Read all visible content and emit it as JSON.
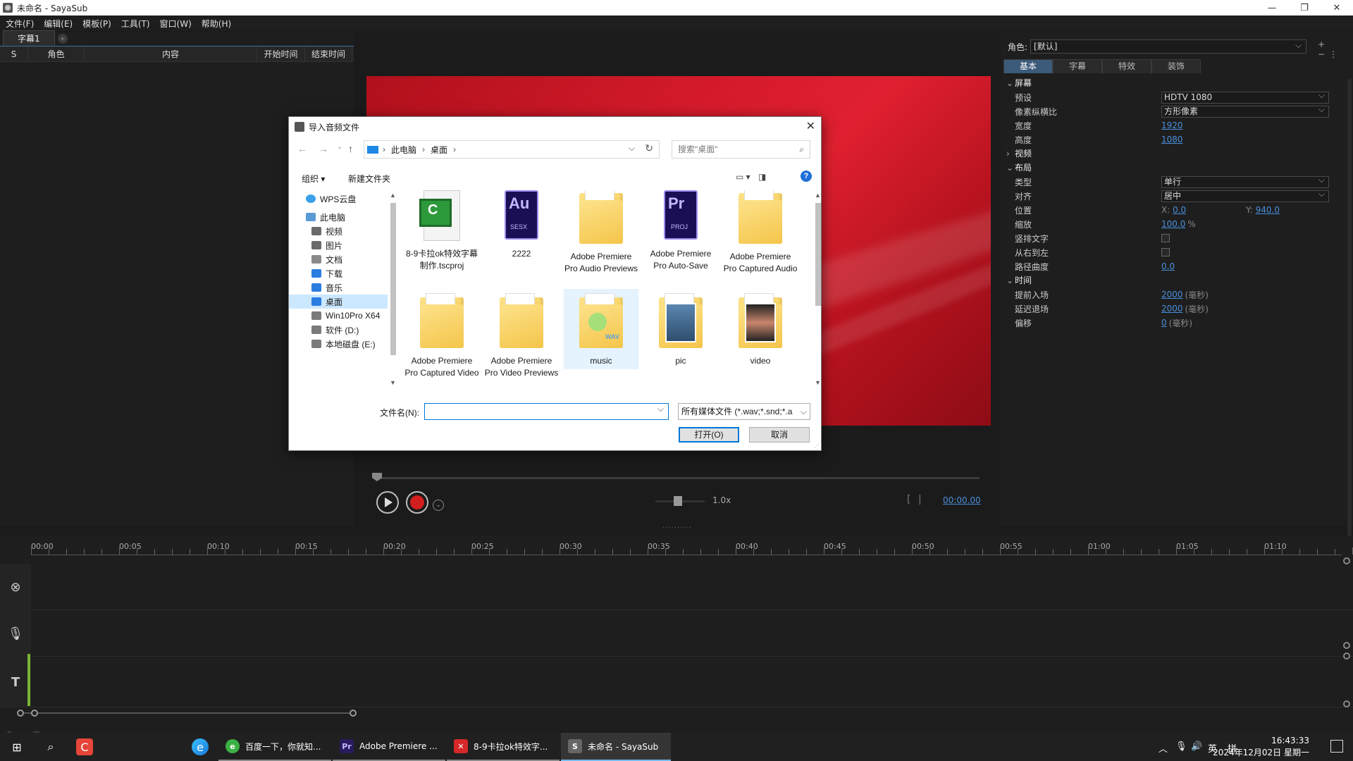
{
  "window": {
    "title": "未命名 - SayaSub",
    "buttons": [
      "—",
      "❐",
      "✕"
    ]
  },
  "menu": [
    "文件(F)",
    "编辑(E)",
    "模板(P)",
    "工具(T)",
    "窗口(W)",
    "帮助(H)"
  ],
  "subtitle_list": {
    "tab": "字幕1",
    "columns": [
      "S",
      "角色",
      "内容",
      "开始时间",
      "结束时间"
    ]
  },
  "player": {
    "speed": "1.0x",
    "time": "00:00.00"
  },
  "properties": {
    "role_label": "角色:",
    "role_value": "[默认]",
    "tabs": [
      "基本",
      "字幕",
      "特效",
      "装饰"
    ],
    "sections": {
      "screen": "屏幕",
      "view": "视频",
      "layout": "布局",
      "time": "时间"
    },
    "preset_label": "预设",
    "preset_value": "HDTV 1080",
    "pixel_label": "像素纵横比",
    "pixel_value": "方形像素",
    "width_label": "宽度",
    "width_value": "1920",
    "height_label": "高度",
    "height_value": "1080",
    "type_label": "类型",
    "type_value": "单行",
    "align_label": "对齐",
    "align_value": "居中",
    "pos_label": "位置",
    "pos_x_label": "X:",
    "pos_x": "0.0",
    "pos_y_label": "Y:",
    "pos_y": "940.0",
    "scale_label": "缩放",
    "scale_value": "100.0",
    "scale_unit": "%",
    "vertical_label": "竖排文字",
    "rtl_label": "从右到左",
    "curve_label": "路径曲度",
    "curve_value": "0.0",
    "lead_in_label": "提前入场",
    "lead_in_value": "2000",
    "lead_out_label": "延迟退场",
    "lead_out_value": "2000",
    "offset_label": "偏移",
    "offset_value": "0",
    "ms_unit": "(毫秒)"
  },
  "timeline": {
    "labels": [
      "00:00",
      "00:05",
      "00:10",
      "00:15",
      "00:20",
      "00:25",
      "00:30",
      "00:35",
      "00:40",
      "00:45",
      "00:50",
      "00:55",
      "01:00",
      "01:05",
      "01:10"
    ]
  },
  "dialog": {
    "title": "导入音频文件",
    "crumbs": [
      "此电脑",
      "桌面"
    ],
    "search_placeholder": "搜索\"桌面\"",
    "organize": "组织 ▾",
    "new_folder": "新建文件夹",
    "nav": [
      {
        "label": "WPS云盘",
        "color": "#3aa0e8"
      },
      {
        "label": "此电脑",
        "color": "#5b9bd5"
      },
      {
        "label": "视频",
        "color": "#6a6a6a"
      },
      {
        "label": "图片",
        "color": "#6a6a6a"
      },
      {
        "label": "文档",
        "color": "#8a8a8a"
      },
      {
        "label": "下载",
        "color": "#2a7de1"
      },
      {
        "label": "音乐",
        "color": "#2a7de1"
      },
      {
        "label": "桌面",
        "color": "#2a7de1"
      },
      {
        "label": "Win10Pro X64",
        "color": "#7a7a7a"
      },
      {
        "label": "软件 (D:)",
        "color": "#7a7a7a"
      },
      {
        "label": "本地磁盘 (E:)",
        "color": "#7a7a7a"
      }
    ],
    "files": [
      {
        "label": "8-9卡拉ok特效字幕制作.tscproj",
        "icon": "camtasia-icon"
      },
      {
        "label": "2222",
        "icon": "audition-icon"
      },
      {
        "label": "Adobe Premiere Pro Audio Previews",
        "icon": "folder-icon"
      },
      {
        "label": "Adobe Premiere Pro Auto-Save",
        "icon": "premiere-icon"
      },
      {
        "label": "Adobe Premiere Pro Captured Audio",
        "icon": "folder-icon"
      },
      {
        "label": "Adobe Premiere Pro Captured Video",
        "icon": "folder-icon"
      },
      {
        "label": "Adobe Premiere Pro Video Previews",
        "icon": "folder-icon"
      },
      {
        "label": "music",
        "icon": "folder-music-icon"
      },
      {
        "label": "pic",
        "icon": "folder-pic-icon"
      },
      {
        "label": "video",
        "icon": "folder-video-icon"
      }
    ],
    "filename_label": "文件名(N):",
    "filename_value": "",
    "filetype": "所有媒体文件 (*.wav;*.snd;*.a",
    "open_button": "打开(O)",
    "cancel_button": "取消"
  },
  "taskbar": {
    "apps": [
      {
        "label": "百度一下，你就知...",
        "color": "#3cb043",
        "glyph": "e"
      },
      {
        "label": "Adobe Premiere ...",
        "color": "#2a1a5e",
        "glyph": "Pr"
      },
      {
        "label": "8-9卡拉ok特效字...",
        "color": "#d62828",
        "glyph": "✕"
      },
      {
        "label": "未命名 - SayaSub",
        "color": "#666666",
        "glyph": "S"
      }
    ],
    "ime": "英",
    "ime2": "拼",
    "time": "16:43:33",
    "date": "2024年12月02日 星期一"
  },
  "colors": {
    "accent": "#4a8fdc",
    "dialog_accent": "#0078d7",
    "record": "#d21e1e",
    "preview_red": "#d31a2a"
  }
}
